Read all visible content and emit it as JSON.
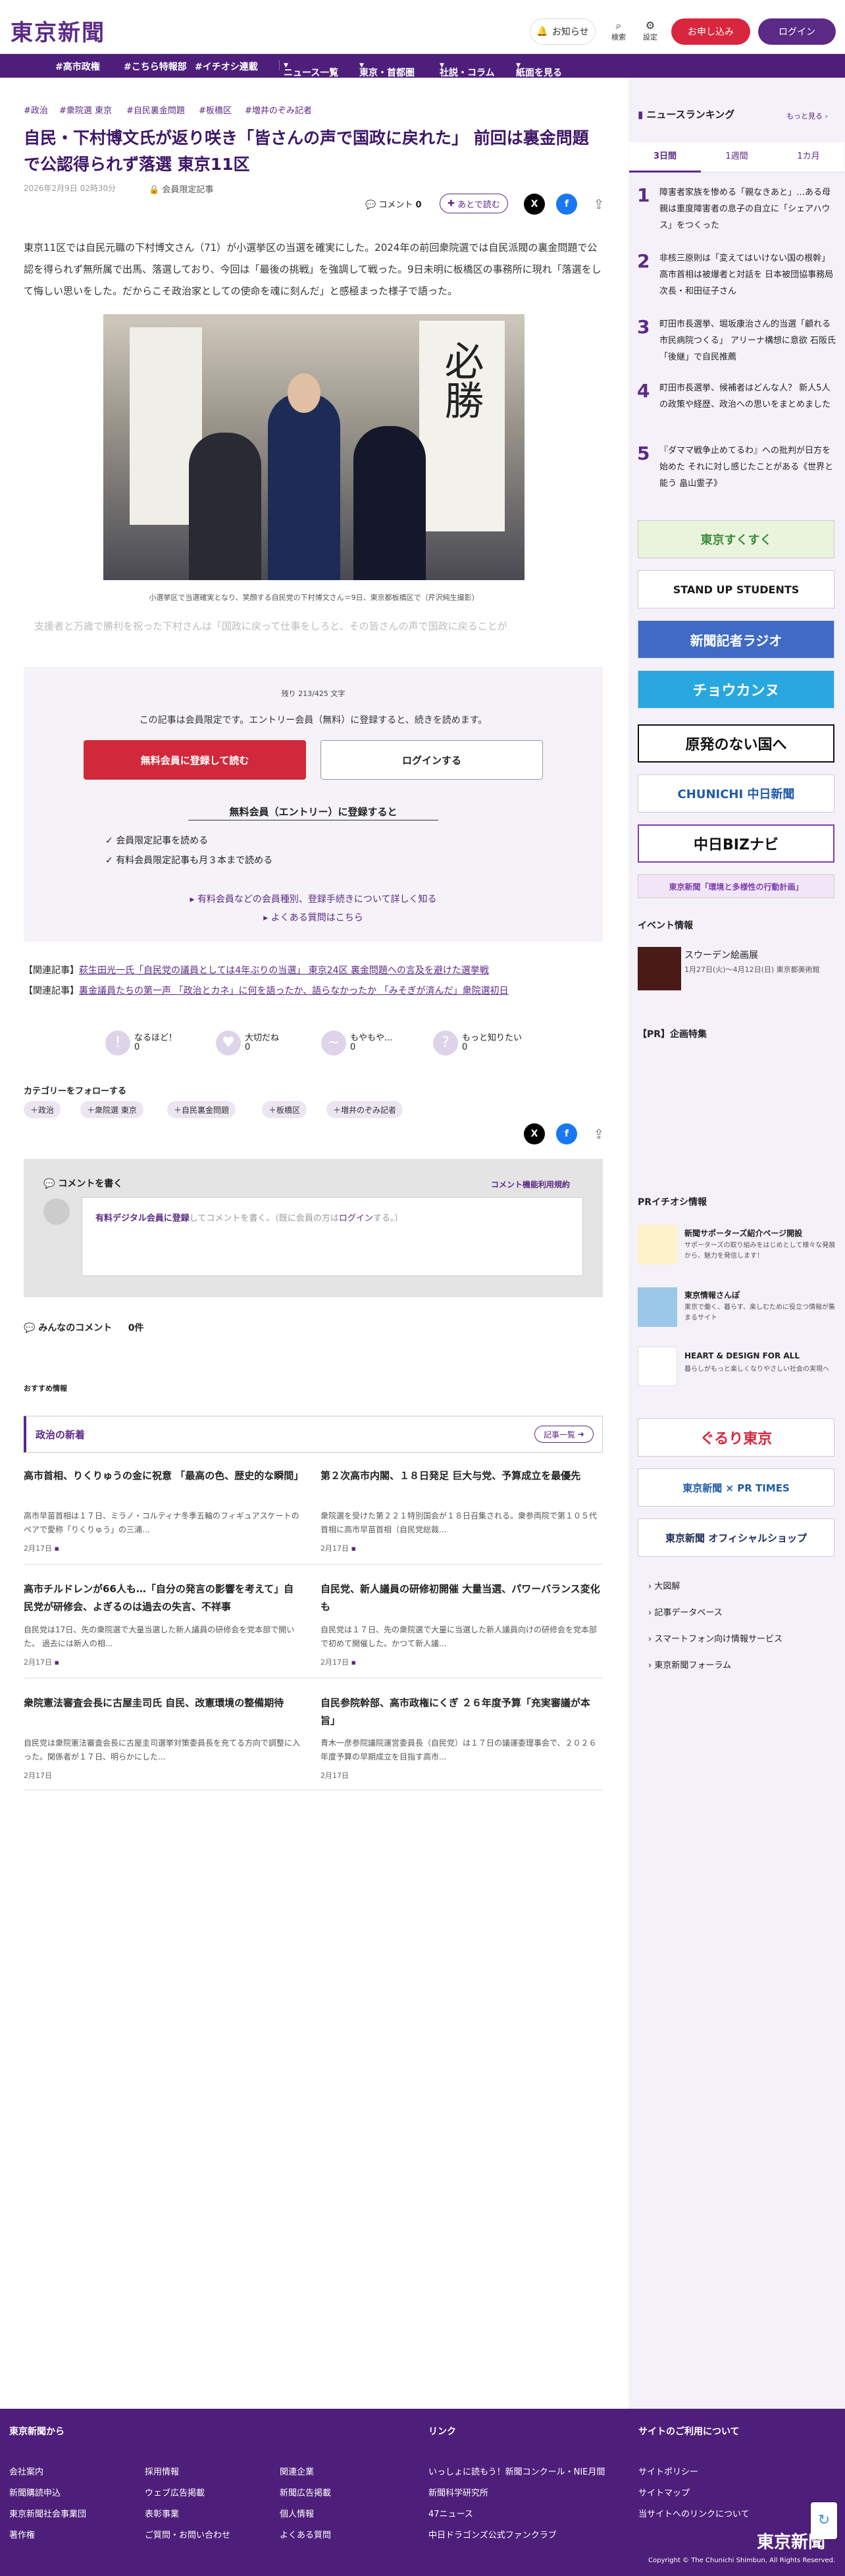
{
  "header": {
    "logo": "東京新聞",
    "notice_label": "お知らせ",
    "search_label": "検索",
    "settings_label": "設定",
    "subscribe_label": "お申し込み",
    "login_label": "ログイン"
  },
  "nav": {
    "items": [
      "#高市政権",
      "#こちら特報部",
      "#イチオシ連載",
      "ニュース一覧",
      "東京・首都圏",
      "社説・コラム",
      "紙面を見る"
    ]
  },
  "article": {
    "tags": [
      "#政治",
      "#衆院選 東京",
      "#自民裏金問題",
      "#板橋区",
      "#増井のぞみ記者"
    ],
    "title": "自民・下村博文氏が返り咲き「皆さんの声で国政に戻れた」 前回は裏金問題で公認得られず落選 東京11区",
    "date": "2026年2月9日 02時30分",
    "member_only": "会員限定記事",
    "comment_label": "コメント",
    "comment_count": "0",
    "read_later": "あとで読む",
    "body": "東京11区では自民元職の下村博文さん（71）が小選挙区の当選を確実にした。2024年の前回衆院選では自民派閥の裏金問題で公認を得られず無所属で出馬、落選しており、今回は「最後の挑戦」を強調して戦った。9日未明に板橋区の事務所に現れ「落選をして悔しい思いをした。だからこそ政治家としての使命を魂に刻んだ」と感極まった様子で語った。",
    "photo_caption": "小選挙区で当選確実となり、笑顔する自民党の下村博文さん＝9日、東京都板橋区で（芹沢純生撮影）",
    "teaser": "支援者と万歳で勝利を祝った下村さんは「国政に戻って仕事をしろと、その皆さんの声で国政に戻ることが"
  },
  "paywall": {
    "remaining": "残り 213/425 文字",
    "message": "この記事は会員限定です。エントリー会員（無料）に登録すると、続きを読めます。",
    "register_btn": "無料会員に登録して読む",
    "login_btn": "ログインする",
    "benefits_title": "無料会員（エントリー）に登録すると",
    "benefits": [
      "会員限定記事を読める",
      "有料会員限定記事も月３本まで読める"
    ],
    "more_link": "有料会員などの会員種別、登録手続きについて詳しく知る",
    "faq_link": "よくある質問はこちら"
  },
  "related": [
    {
      "label": "【関連記事】",
      "text": "萩生田光一氏「自民党の議員としては4年ぶりの当選」 東京24区 裏金問題への言及を避けた選挙戦"
    },
    {
      "label": "【関連記事】",
      "text": "裏金議員たちの第一声 「政治とカネ」に何を語ったか、語らなかったか 「みそぎが済んだ」衆院選初日"
    }
  ],
  "reactions": [
    {
      "label": "なるほど！",
      "count": "0"
    },
    {
      "label": "大切だね",
      "count": "0"
    },
    {
      "label": "もやもや...",
      "count": "0"
    },
    {
      "label": "もっと知りたい",
      "count": "0"
    }
  ],
  "follow": {
    "title": "カテゴリーをフォローする",
    "tags": [
      "政治",
      "衆院選 東京",
      "自民裏金問題",
      "板橋区",
      "増井のぞみ記者"
    ]
  },
  "comment_box": {
    "title": "コメントを書く",
    "policy": "コメント機能利用規約",
    "prompt_link": "有料デジタル会員に登録",
    "prompt_mid": "してコメントを書く。（既に会員の方は",
    "prompt_login": "ログイン",
    "prompt_end": "する。）",
    "everyone": "みんなのコメント",
    "everyone_count": "0件"
  },
  "recommend": {
    "label": "おすすめ情報",
    "section_title": "政治の新着",
    "list_btn": "記事一覧",
    "items": [
      {
        "title": "高市首相、りくりゅうの金に祝意 「最高の色、歴史的な瞬間」",
        "body": "高市早苗首相は１７日、ミラノ・コルティナ冬季五輪のフィギュアスケートのペアで愛称「りくりゅう」の三浦...",
        "date": "2月17日"
      },
      {
        "title": "第２次高市内閣、１８日発足 巨大与党、予算成立を最優先",
        "body": "衆院選を受けた第２２１特別国会が１８日召集される。衆参両院で第１０５代首相に高市早苗首相（自民党総裁...",
        "date": "2月17日"
      },
      {
        "title": "高市チルドレンが66人も…「自分の発言の影響を考えて」自民党が研修会、よぎるのは過去の失言、不祥事",
        "body": "自民党は17日、先の衆院選で大量当選した新人議員の研修会を党本部で開いた。 過去には新人の相...",
        "date": "2月17日"
      },
      {
        "title": "自民党、新人議員の研修初開催 大量当選、パワーバランス変化も",
        "body": "自民党は１７日、先の衆院選で大量に当選した新人議員向けの研修会を党本部で初めて開催した。かつて新人議...",
        "date": "2月17日"
      },
      {
        "title": "衆院憲法審査会長に古屋圭司氏 自民、改憲環境の整備期待",
        "body": "自民党は衆院憲法審査会長に古屋圭司選挙対策委員長を充てる方向で調整に入った。関係者が１７日、明らかにした...",
        "date": "2月17日"
      },
      {
        "title": "自民参院幹部、高市政権にくぎ ２６年度予算「充実審議が本旨」",
        "body": "青木一彦参院議院運営委員長（自民党）は１７日の議運委理事会で、２０２６年度予算の早期成立を目指す高市...",
        "date": "2月17日"
      }
    ]
  },
  "sidebar": {
    "ranking_title": "ニュースランキング",
    "ranking_more": "もっと見る",
    "tabs": [
      "3日間",
      "1週間",
      "1カ月"
    ],
    "ranking": [
      {
        "n": "1",
        "text": "障害者家族を惨める「親なきあと」…ある母親は重度障害者の息子の自立に「シェアハウス」をつくった"
      },
      {
        "n": "2",
        "text": "非核三原則は「変えてはいけない国の根幹」 高市首相は被爆者と対話を 日本被団協事務局次長・和田征子さん"
      },
      {
        "n": "3",
        "text": "町田市長選挙、堀坂康治さん的当選「顧れる市民病院つくる」 アリーナ構想に意欲 石阪氏「後継」で自民推薦"
      },
      {
        "n": "4",
        "text": "町田市長選挙、候補者はどんな人？ 新人5人の政策や経歴、政治への思いをまとめました"
      },
      {
        "n": "5",
        "text": "『ダママ戦争止めてるわ』への批判が日方を始めた それに対し感じたことがある《世界と能う 畠山霊子》"
      }
    ],
    "banners": [
      "東京すくすく",
      "STAND UP STUDENTS",
      "新聞記者ラジオ",
      "チョウカンヌ",
      "原発のない国へ",
      "CHUNICHI 中日新聞",
      "中日BIZナビ",
      "東京新聞「環境と多様性の行動計画」"
    ],
    "event_title": "イベント情報",
    "event_name": "スウーデン絵画展",
    "event_desc": "1月27日(火)〜4月12日(日) 東京都美術館",
    "pr_special": "【PR】企画特集",
    "pr_info": "PRイチオシ情報",
    "pr_items": [
      {
        "title": "新聞サポーターズ紹介ページ開設",
        "desc": "サポーターズの取り組みをはじめとして様々な発展から、魅力を発信します！"
      },
      {
        "title": "東京情報さんぽ",
        "desc": "東京で働く、暮らす、楽しむために役立つ情報が集まるサイト"
      },
      {
        "title": "HEART & DESIGN FOR ALL",
        "desc": "暮らしがもっと楽しくなりやさしい社会の実現へ"
      }
    ],
    "banners2": [
      "ぐるり東京",
      "東京新聞 × PR TIMES",
      "東京新聞 オフィシャルショップ"
    ],
    "links": [
      "大図解",
      "記事データベース",
      "スマートフォン向け情報サービス",
      "東京新聞フォーラム"
    ]
  },
  "footer": {
    "col1_title": "東京新聞から",
    "col1_links": [
      "会社案内",
      "新聞購読申込",
      "東京新聞社会事業団",
      "著作権",
      "採用情報",
      "ウェブ広告掲載",
      "表彰事業",
      "ご質問・お問い合わせ",
      "関連企業",
      "新聞広告掲載",
      "個人情報",
      "よくある質問"
    ],
    "col2_title": "リンク",
    "col2_links": [
      "いっしょに読もう！新聞コンクール・NIE月間",
      "新聞科学研究所",
      "47ニュース",
      "中日ドラゴンズ公式ファンクラブ"
    ],
    "col3_title": "サイトのご利用について",
    "col3_links": [
      "サイトポリシー",
      "サイトマップ",
      "当サイトへのリンクについて"
    ],
    "logo": "東京新聞",
    "copyright": "Copyright © The Chunichi Shimbun, All Rights Reserved."
  }
}
